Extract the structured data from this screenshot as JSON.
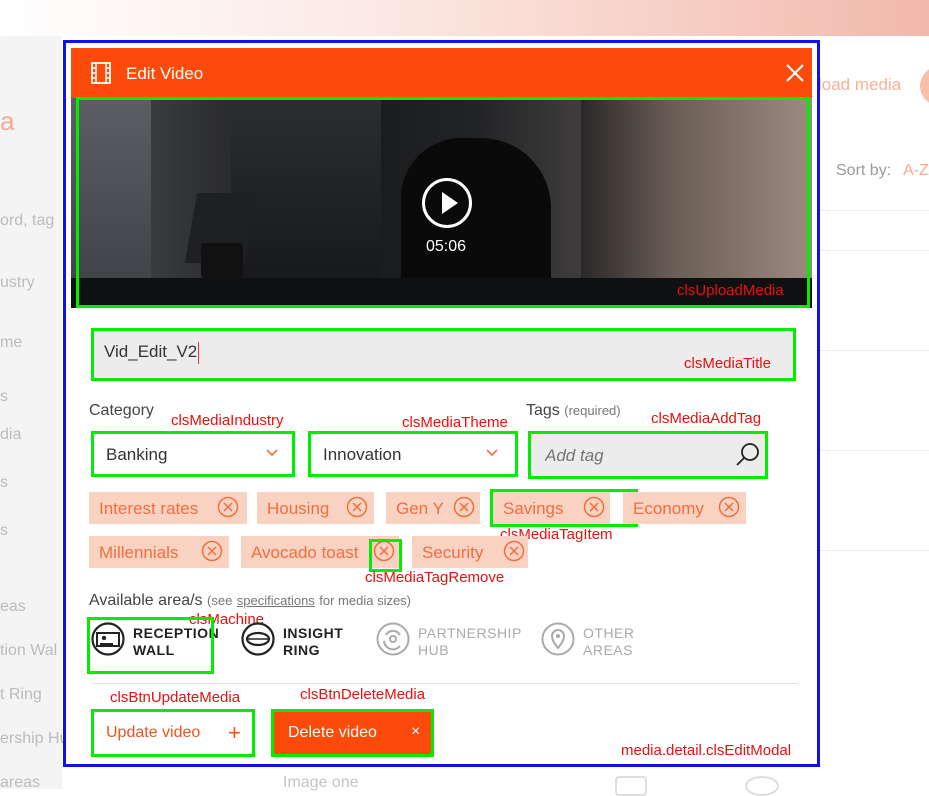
{
  "background": {
    "upload_label": "load media",
    "sort_label": "Sort by:",
    "sort_value": "A-Z",
    "sidebar_items": [
      "ord, tag",
      "ustry",
      "me",
      "s",
      "dia",
      "s",
      "s",
      "eas",
      "tion Wal",
      "t Ring",
      "ership Hu",
      "areas"
    ],
    "bottom_item": "Image one"
  },
  "modal": {
    "title": "Edit Video",
    "video": {
      "duration": "05:06"
    },
    "media_title_value": "Vid_Edit_V2",
    "category_label": "Category",
    "industry_value": "Banking",
    "theme_value": "Innovation",
    "tags_label": "Tags",
    "tags_required": "(required)",
    "add_tag_placeholder": "Add tag",
    "tags": [
      "Interest rates",
      "Housing",
      "Gen Y",
      "Savings",
      "Economy",
      "Millennials",
      "Avocado toast",
      "Security"
    ],
    "areas_label": "Available area/s",
    "areas_note_pre": "(see",
    "areas_note_link": "specifications",
    "areas_note_post": "for media sizes)",
    "areas": [
      {
        "line1": "RECEPTION",
        "line2": "WALL"
      },
      {
        "line1": "INSIGHT",
        "line2": "RING"
      },
      {
        "line1": "PARTNERSHIP",
        "line2": "HUB"
      },
      {
        "line1": "OTHER",
        "line2": "AREAS"
      }
    ],
    "update_label": "Update video",
    "update_icon": "+",
    "delete_label": "Delete video",
    "delete_icon": "×"
  },
  "annotations": {
    "upload_media": "clsUploadMedia",
    "media_title": "clsMediaTitle",
    "media_industry": "clsMediaIndustry",
    "media_theme": "clsMediaTheme",
    "media_add_tag": "clsMediaAddTag",
    "media_tag_item": "clsMediaTagItem",
    "media_tag_remove": "clsMediaTagRemove",
    "machine": "clsMachine",
    "btn_update": "clsBtnUpdateMedia",
    "btn_delete": "clsBtnDeleteMedia",
    "edit_modal": "media.detail.clsEditModal"
  },
  "colors": {
    "accent": "#fb4a0a",
    "tag_bg": "#fad2c2",
    "tag_text": "#f06f3e",
    "highlight": "#00ee00",
    "modal_border": "#1010e8",
    "annotation": "#e81010"
  },
  "icons": [
    "film-icon",
    "close-icon",
    "play-icon",
    "chevron-down-icon",
    "search-icon",
    "remove-tag-icon",
    "reception-wall-icon",
    "insight-ring-icon",
    "partnership-hub-icon",
    "other-areas-icon"
  ]
}
